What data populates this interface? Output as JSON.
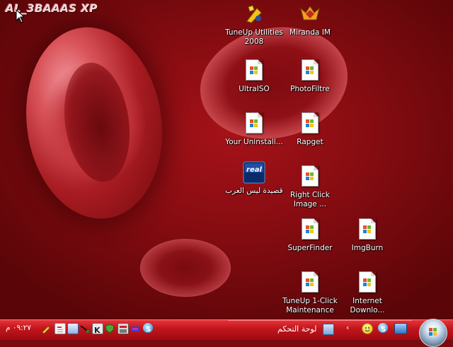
{
  "desktop": {
    "logo_text": "AL_3BAAAS XP",
    "icons": [
      {
        "label": "TuneUp Utilities 2008",
        "icon": "tuneup-utilities-icon"
      },
      {
        "label": "Miranda IM",
        "icon": "miranda-im-icon"
      },
      {
        "label": "UltraISO",
        "icon": "generic-file-icon"
      },
      {
        "label": "PhotoFiltre",
        "icon": "generic-file-icon"
      },
      {
        "label": "Your Uninstall...",
        "icon": "generic-file-icon"
      },
      {
        "label": "Rapget",
        "icon": "generic-file-icon"
      },
      {
        "label": "قصيدة ليس العرب",
        "icon": "realplayer-icon"
      },
      {
        "label": "Right Click Image ...",
        "icon": "generic-file-icon"
      },
      {
        "label": "SuperFinder",
        "icon": "generic-file-icon"
      },
      {
        "label": "ImgBurn",
        "icon": "generic-file-icon"
      },
      {
        "label": "TuneUp 1-Click Maintenance",
        "icon": "generic-file-icon"
      },
      {
        "label": "Internet Downlo...",
        "icon": "generic-file-icon"
      }
    ]
  },
  "taskbar": {
    "clock": "٠٩:٢٧ م",
    "control_panel_label": "لوحة التحكم",
    "chevron": "‹",
    "realplayer_text": "real",
    "tray_icons": [
      "pen-icon",
      "document-icon",
      "window-icon",
      "network-icon",
      "k-icon",
      "shield-icon",
      "app-icon",
      "media-icon",
      "skype-icon"
    ],
    "quick_launch": [
      "messenger-smiley-icon",
      "skype-icon",
      "desktop-icon"
    ]
  },
  "colors": {
    "taskbar_red": "#c4161d",
    "wallpaper_red": "#8a0d12"
  }
}
